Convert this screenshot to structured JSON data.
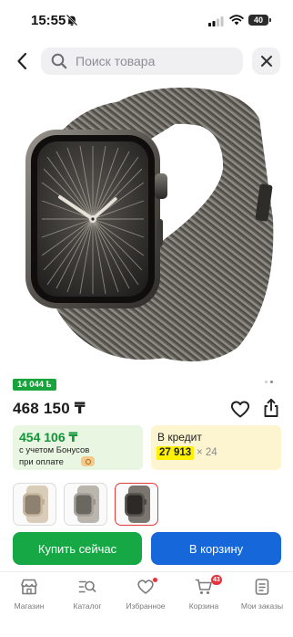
{
  "status_bar": {
    "time": "15:55",
    "battery": "40"
  },
  "header": {
    "search_placeholder": "Поиск товара",
    "icons": [
      "chevron-left-icon",
      "search-icon",
      "close-icon"
    ]
  },
  "gallery": {
    "slide_count": 2,
    "active_slide": 1
  },
  "product": {
    "bonus_badge": "14 044 ҍ",
    "price": "468 150 ₸"
  },
  "bonus_offer": {
    "price": "454 106 ₸",
    "line1": "с учетом Бонусов",
    "line2": "при оплате"
  },
  "credit_offer": {
    "title": "В кредит",
    "monthly_amount": "27 913",
    "months": "× 24"
  },
  "variants": [
    {
      "color": "#c9b9a3",
      "selected": false
    },
    {
      "color": "#a7a39c",
      "selected": false
    },
    {
      "color": "#5a5752",
      "selected": true
    }
  ],
  "actions": {
    "buy_now": "Купить сейчас",
    "add_to_cart": "В корзину"
  },
  "tabs": [
    {
      "label": "Магазин",
      "icon": "store-icon"
    },
    {
      "label": "Каталог",
      "icon": "catalog-search-icon"
    },
    {
      "label": "Избранное",
      "icon": "heart-icon",
      "has_dot": true
    },
    {
      "label": "Корзина",
      "icon": "cart-icon",
      "badge": "43"
    },
    {
      "label": "Мои заказы",
      "icon": "orders-icon"
    }
  ],
  "colors": {
    "green": "#16a845",
    "blue": "#1667d9",
    "red": "#e8313b",
    "credit_highlight": "#fff100"
  }
}
